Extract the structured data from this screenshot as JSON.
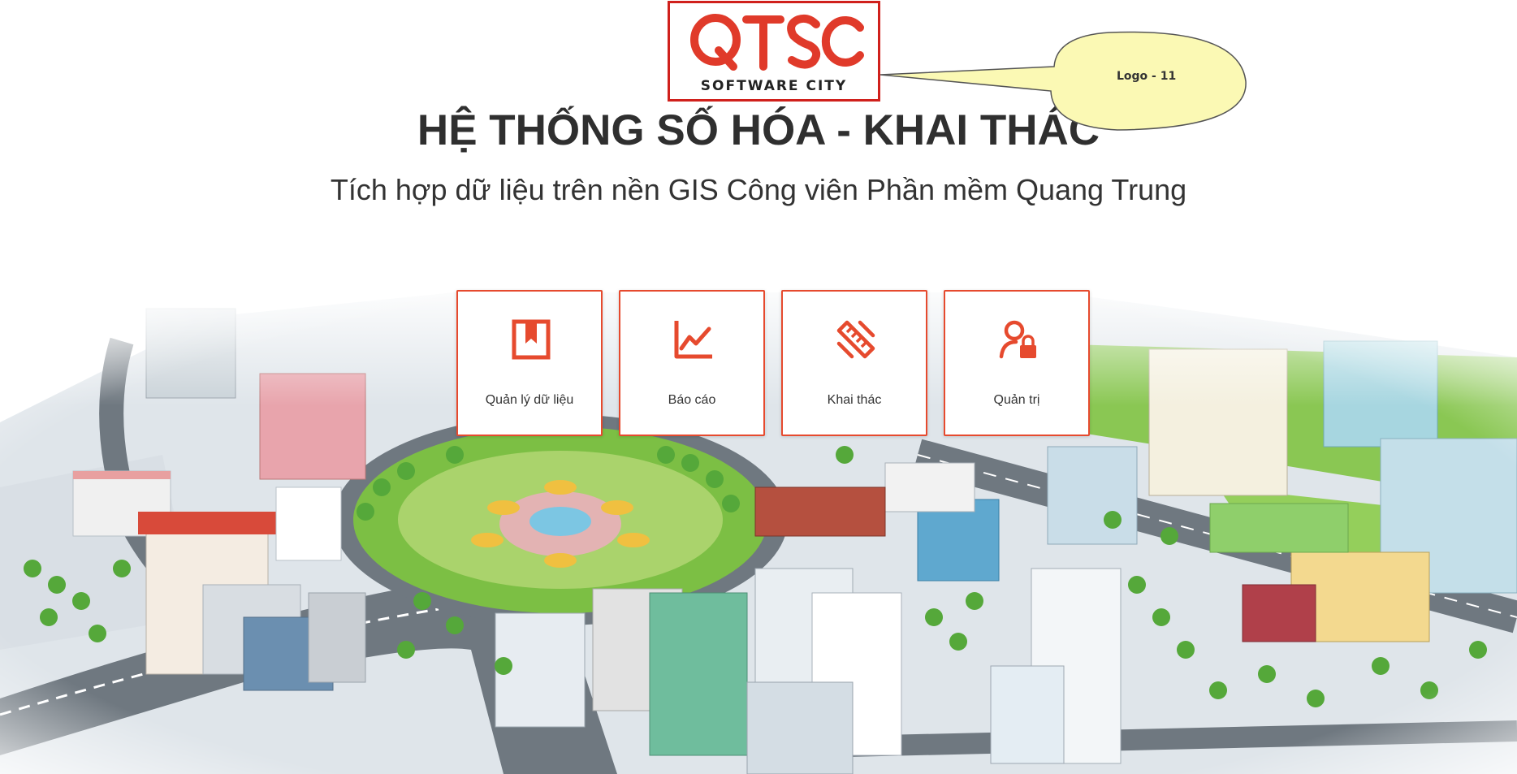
{
  "logo": {
    "mark_text": "QTSC",
    "subtitle": "SOFTWARE CITY",
    "brand_color": "#d0201c"
  },
  "callout": {
    "label": "Logo - 11",
    "fill_color": "#fbf9b4"
  },
  "page": {
    "title": "HỆ THỐNG SỐ HÓA - KHAI THÁC",
    "subtitle": "Tích hợp dữ liệu trên nền GIS Công viên Phần mềm Quang Trung"
  },
  "menu": {
    "accent_color": "#e64a2e",
    "items": [
      {
        "label": "Quản lý dữ liệu",
        "icon": "bookmark-book-icon"
      },
      {
        "label": "Báo cáo",
        "icon": "line-chart-icon"
      },
      {
        "label": "Khai thác",
        "icon": "pencil-ruler-icon"
      },
      {
        "label": "Quản trị",
        "icon": "user-lock-icon"
      }
    ]
  }
}
